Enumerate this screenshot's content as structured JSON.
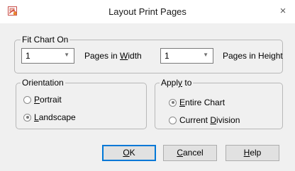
{
  "window": {
    "title": "Layout Print Pages",
    "close_glyph": "×",
    "icon": "app-icon"
  },
  "fit_chart": {
    "legend": "Fit Chart On",
    "width_value": "1",
    "width_label": [
      "Pages in ",
      "W",
      "idth"
    ],
    "height_value": "1",
    "height_label": [
      "Pages in Hei",
      "g",
      "ht"
    ]
  },
  "orientation": {
    "legend": "Orientation",
    "options": [
      {
        "pre": "",
        "u": "P",
        "post": "ortrait",
        "selected": false
      },
      {
        "pre": "",
        "u": "L",
        "post": "andscape",
        "selected": true
      }
    ]
  },
  "apply_to": {
    "legend": [
      "Appl",
      "y",
      " to"
    ],
    "options": [
      {
        "pre": "",
        "u": "E",
        "post": "ntire Chart",
        "selected": true
      },
      {
        "pre": "Current ",
        "u": "D",
        "post": "ivision",
        "selected": false
      }
    ]
  },
  "buttons": {
    "ok": {
      "pre": "",
      "u": "O",
      "post": "K"
    },
    "cancel": {
      "pre": "",
      "u": "C",
      "post": "ancel"
    },
    "help": {
      "pre": "",
      "u": "H",
      "post": "elp"
    }
  },
  "colors": {
    "accent": "#0078d7",
    "dialog_bg": "#f0f0f0"
  }
}
